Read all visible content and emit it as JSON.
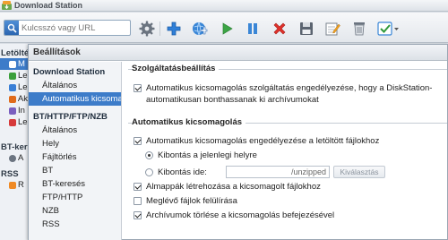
{
  "app": {
    "title": "Download Station"
  },
  "search": {
    "placeholder": "Kulcsszó vagy URL"
  },
  "toolbar": {
    "buttons": [
      "gear-icon",
      "add-icon",
      "add-url-icon",
      "play-icon",
      "pause-icon",
      "delete-icon",
      "save-icon",
      "edit-icon",
      "clear-icon",
      "select-icon"
    ]
  },
  "left_panel": {
    "heading": "Letölté",
    "items": [
      {
        "label": "M",
        "color": "#3d7cc9"
      },
      {
        "label": "Le",
        "color": "#3b9f3b"
      },
      {
        "label": "Le",
        "color": "#3a7fd6"
      },
      {
        "label": "Ak",
        "color": "#e06b1b"
      },
      {
        "label": "In",
        "color": "#7a5fbf"
      },
      {
        "label": "Le",
        "color": "#d63a3a"
      }
    ],
    "bt_heading": "BT-kere",
    "bt_items": [
      {
        "label": "A"
      }
    ],
    "rss_heading": "RSS",
    "rss_items": [
      {
        "label": "R"
      }
    ]
  },
  "dialog": {
    "title": "Beállítások",
    "nav": {
      "group1": "Download Station",
      "group1_items": [
        "Általános",
        "Automatikus kicsomagolás"
      ],
      "group2": "BT/HTTP/FTP/NZB",
      "group2_items": [
        "Általános",
        "Hely",
        "Fájltörlés",
        "BT",
        "BT-keresés",
        "FTP/HTTP",
        "NZB",
        "RSS"
      ]
    },
    "service": {
      "legend": "Szolgáltatásbeállítás",
      "checkbox_label": "Automatikus kicsomagolás szolgáltatás engedélyezése, hogy a DiskStation-automatikusan bonthassanak ki archívumokat"
    },
    "auto": {
      "legend": "Automatikus kicsomagolás",
      "enable_label": "Automatikus kicsomagolás engedélyezése a letöltött fájlokhoz",
      "radio_current": "Kibontás a jelenlegi helyre",
      "radio_dest": "Kibontás ide:",
      "dest_value": "/unzipped",
      "browse_label": "Kiválasztás",
      "subfolder_label": "Almappák létrehozása a kicsomagolt fájlokhoz",
      "overwrite_label": "Meglévő fájlok felülírása",
      "delete_label": "Archívumok törlése a kicsomagolás befejezésével"
    }
  }
}
